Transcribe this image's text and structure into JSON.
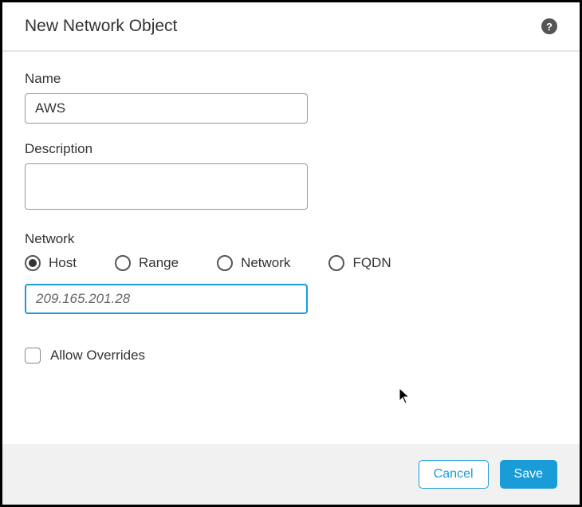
{
  "dialog": {
    "title": "New Network Object"
  },
  "fields": {
    "name": {
      "label": "Name",
      "value": "AWS"
    },
    "description": {
      "label": "Description",
      "value": ""
    },
    "network": {
      "label": "Network",
      "value": "209.165.201.28",
      "options": [
        {
          "label": "Host",
          "selected": true
        },
        {
          "label": "Range",
          "selected": false
        },
        {
          "label": "Network",
          "selected": false
        },
        {
          "label": "FQDN",
          "selected": false
        }
      ]
    },
    "allowOverrides": {
      "label": "Allow Overrides",
      "checked": false
    }
  },
  "buttons": {
    "cancel": "Cancel",
    "save": "Save"
  }
}
